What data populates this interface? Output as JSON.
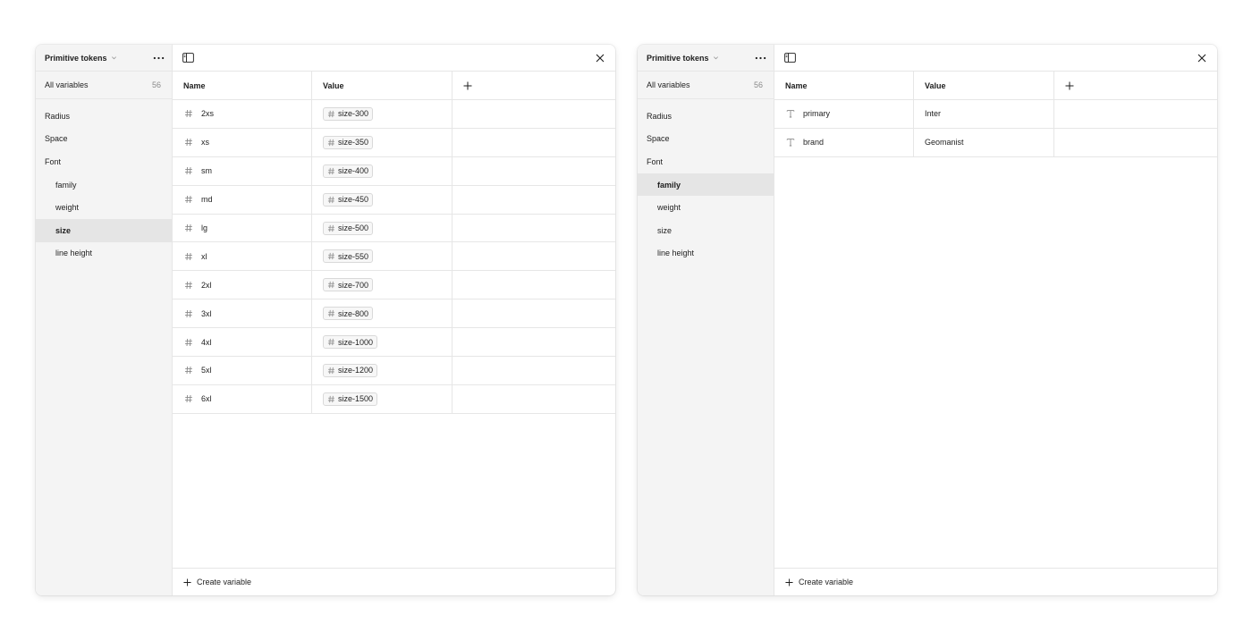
{
  "icons": {
    "collection_chevron": "chevron-down-icon",
    "more": "more-horizontal-icon",
    "sidebar_toggle": "sidebar-toggle-icon",
    "close": "close-icon",
    "add_column": "plus-icon",
    "number_type": "hash-icon",
    "string_type": "text-t-icon",
    "create_variable": "plus-icon"
  },
  "colors": {
    "sidebar_bg": "#f4f4f4",
    "selected_bg": "#e5e5e5",
    "border": "#e6e6e6",
    "muted_text": "#8a8a8a"
  },
  "panels": [
    {
      "collection_name": "Primitive tokens",
      "all_variables_label": "All variables",
      "all_variables_count": "56",
      "groups": [
        {
          "label": "Radius",
          "child": false,
          "selected": false
        },
        {
          "label": "Space",
          "child": false,
          "selected": false
        },
        {
          "label": "Font",
          "child": false,
          "selected": false
        },
        {
          "label": "family",
          "child": true,
          "selected": false
        },
        {
          "label": "weight",
          "child": true,
          "selected": false
        },
        {
          "label": "size",
          "child": true,
          "selected": true
        },
        {
          "label": "line height",
          "child": true,
          "selected": false
        }
      ],
      "columns": {
        "name": "Name",
        "value": "Value"
      },
      "rows": [
        {
          "name": "2xs",
          "type": "number",
          "value": "size-300",
          "alias": true
        },
        {
          "name": "xs",
          "type": "number",
          "value": "size-350",
          "alias": true
        },
        {
          "name": "sm",
          "type": "number",
          "value": "size-400",
          "alias": true
        },
        {
          "name": "md",
          "type": "number",
          "value": "size-450",
          "alias": true
        },
        {
          "name": "lg",
          "type": "number",
          "value": "size-500",
          "alias": true
        },
        {
          "name": "xl",
          "type": "number",
          "value": "size-550",
          "alias": true
        },
        {
          "name": "2xl",
          "type": "number",
          "value": "size-700",
          "alias": true
        },
        {
          "name": "3xl",
          "type": "number",
          "value": "size-800",
          "alias": true
        },
        {
          "name": "4xl",
          "type": "number",
          "value": "size-1000",
          "alias": true
        },
        {
          "name": "5xl",
          "type": "number",
          "value": "size-1200",
          "alias": true
        },
        {
          "name": "6xl",
          "type": "number",
          "value": "size-1500",
          "alias": true
        }
      ],
      "create_label": "Create variable"
    },
    {
      "collection_name": "Primitive tokens",
      "all_variables_label": "All variables",
      "all_variables_count": "56",
      "groups": [
        {
          "label": "Radius",
          "child": false,
          "selected": false
        },
        {
          "label": "Space",
          "child": false,
          "selected": false
        },
        {
          "label": "Font",
          "child": false,
          "selected": false
        },
        {
          "label": "family",
          "child": true,
          "selected": true
        },
        {
          "label": "weight",
          "child": true,
          "selected": false
        },
        {
          "label": "size",
          "child": true,
          "selected": false
        },
        {
          "label": "line height",
          "child": true,
          "selected": false
        }
      ],
      "columns": {
        "name": "Name",
        "value": "Value"
      },
      "rows": [
        {
          "name": "primary",
          "type": "string",
          "value": "Inter",
          "alias": false
        },
        {
          "name": "brand",
          "type": "string",
          "value": "Geomanist",
          "alias": false
        }
      ],
      "create_label": "Create variable"
    }
  ]
}
